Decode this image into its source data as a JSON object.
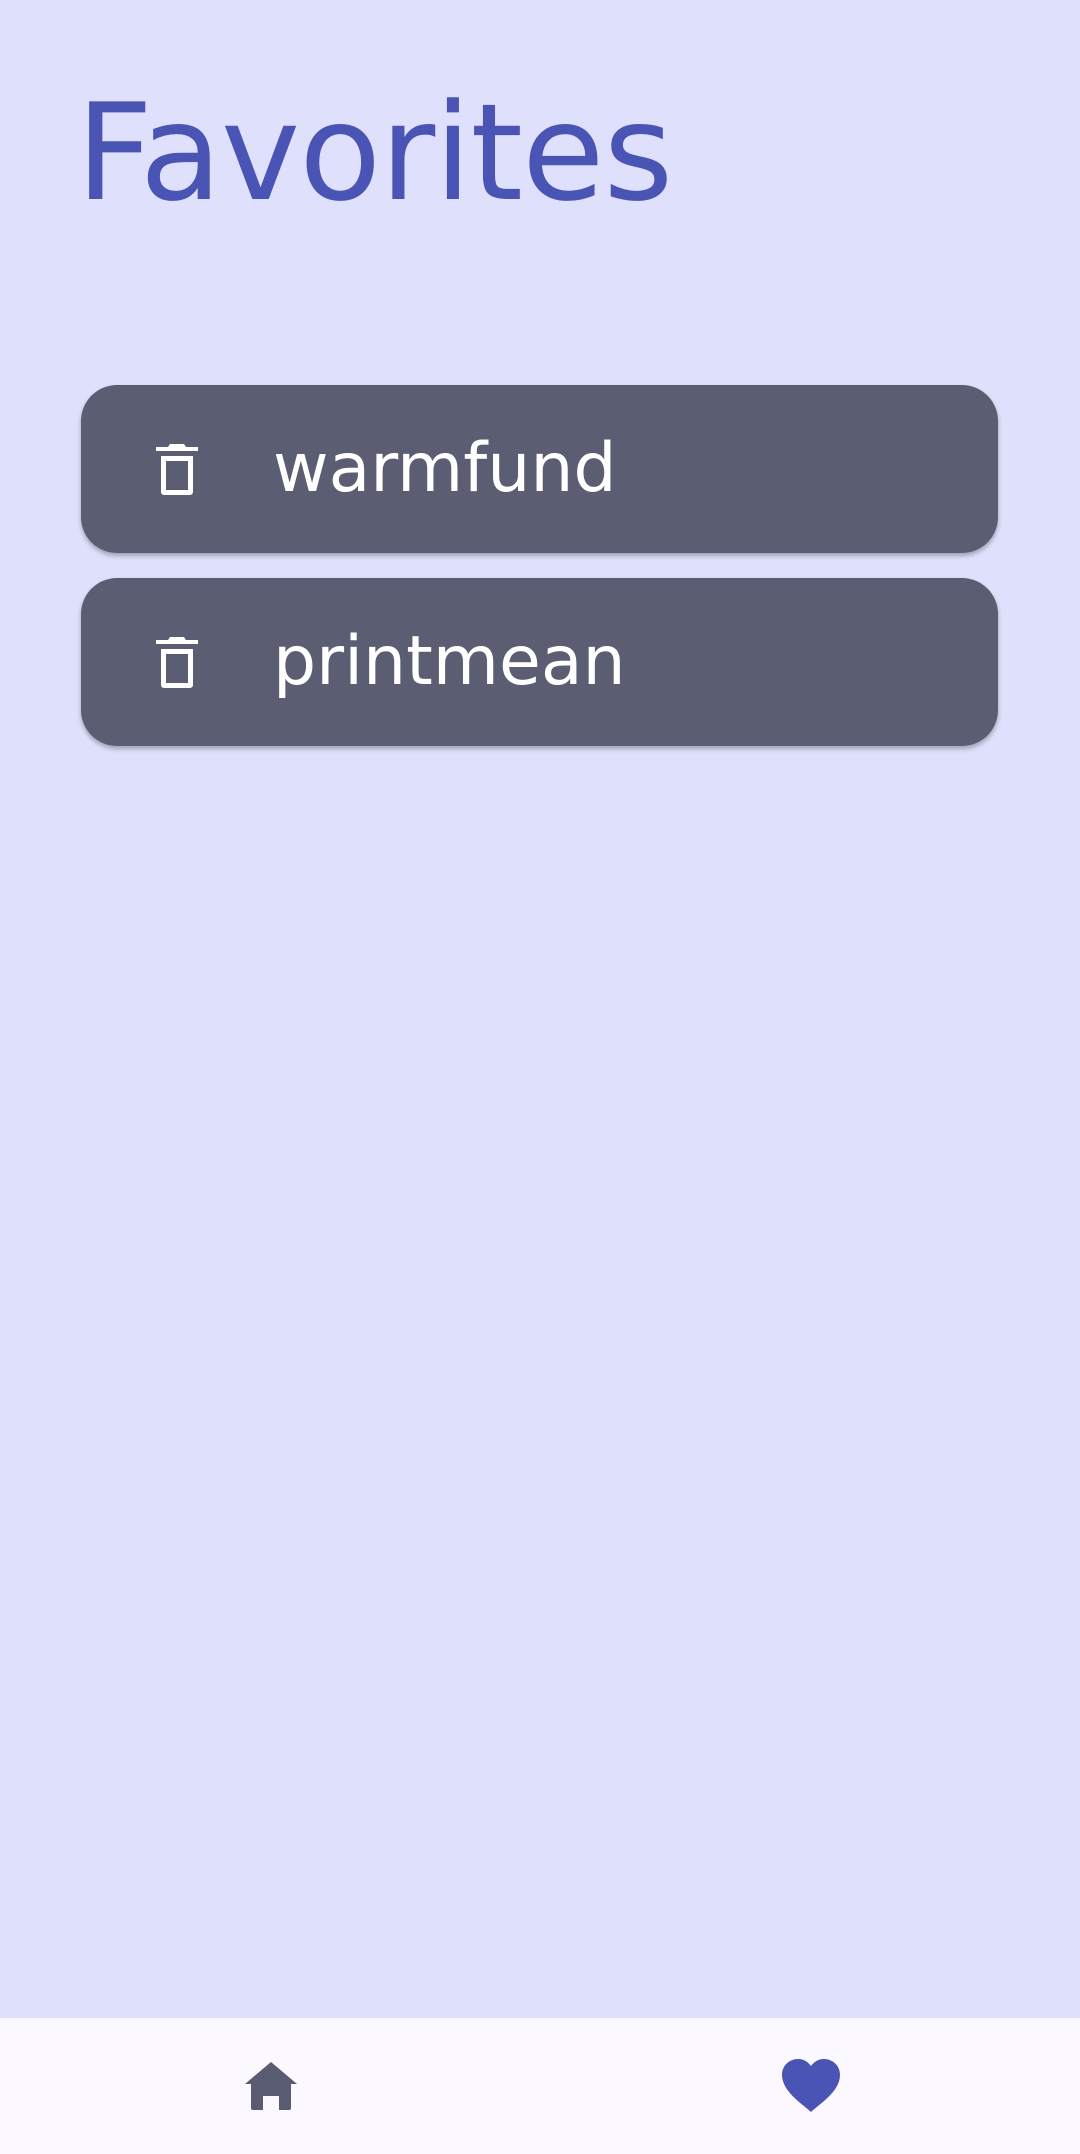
{
  "header": {
    "title": "Favorites"
  },
  "favorites": [
    {
      "label": "warmfund",
      "delete_icon": "trash-icon"
    },
    {
      "label": "printmean",
      "delete_icon": "trash-icon"
    }
  ],
  "bottom_nav": {
    "items": [
      {
        "icon": "home-icon",
        "active": false
      },
      {
        "icon": "heart-icon",
        "active": true
      }
    ]
  },
  "colors": {
    "background": "#DFE0FB",
    "accent": "#4A54B4",
    "card": "#5B5D73",
    "nav_background": "#FBF8FF",
    "nav_inactive": "#585B71"
  }
}
